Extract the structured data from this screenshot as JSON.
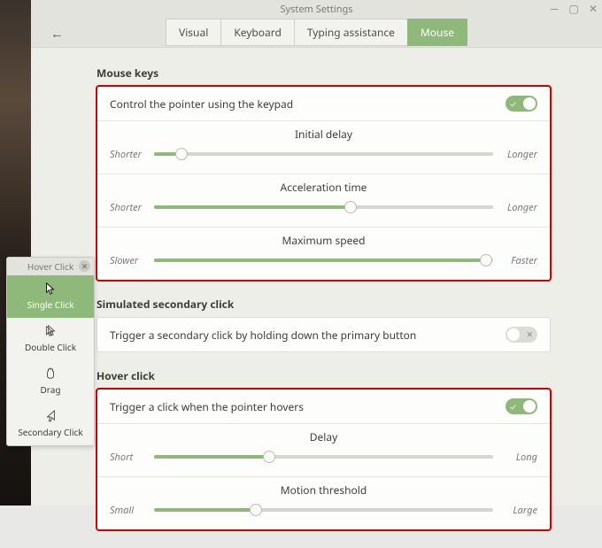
{
  "window": {
    "title": "System Settings"
  },
  "tabs": [
    {
      "label": "Visual",
      "active": false
    },
    {
      "label": "Keyboard",
      "active": false
    },
    {
      "label": "Typing assistance",
      "active": false
    },
    {
      "label": "Mouse",
      "active": true
    }
  ],
  "sections": {
    "mouse_keys": {
      "title": "Mouse keys",
      "control_label": "Control the pointer using the keypad",
      "control_on": true,
      "sliders": {
        "initial_delay": {
          "title": "Initial delay",
          "left": "Shorter",
          "right": "Longer",
          "value": 8
        },
        "acceleration": {
          "title": "Acceleration time",
          "left": "Shorter",
          "right": "Longer",
          "value": 58
        },
        "max_speed": {
          "title": "Maximum speed",
          "left": "Slower",
          "right": "Faster",
          "value": 98
        }
      }
    },
    "sim_secondary": {
      "title": "Simulated secondary click",
      "trigger_label": "Trigger a secondary click by holding down the primary button",
      "trigger_on": false
    },
    "hover_click": {
      "title": "Hover click",
      "trigger_label": "Trigger a click when the pointer hovers",
      "trigger_on": true,
      "sliders": {
        "delay": {
          "title": "Delay",
          "left": "Short",
          "right": "Long",
          "value": 34
        },
        "threshold": {
          "title": "Motion threshold",
          "left": "Small",
          "right": "Large",
          "value": 30
        }
      }
    }
  },
  "palette": {
    "title": "Hover Click",
    "items": [
      {
        "id": "single",
        "label": "Single Click",
        "selected": true
      },
      {
        "id": "double",
        "label": "Double Click",
        "selected": false
      },
      {
        "id": "drag",
        "label": "Drag",
        "selected": false
      },
      {
        "id": "secondary",
        "label": "Secondary Click",
        "selected": false
      }
    ]
  }
}
